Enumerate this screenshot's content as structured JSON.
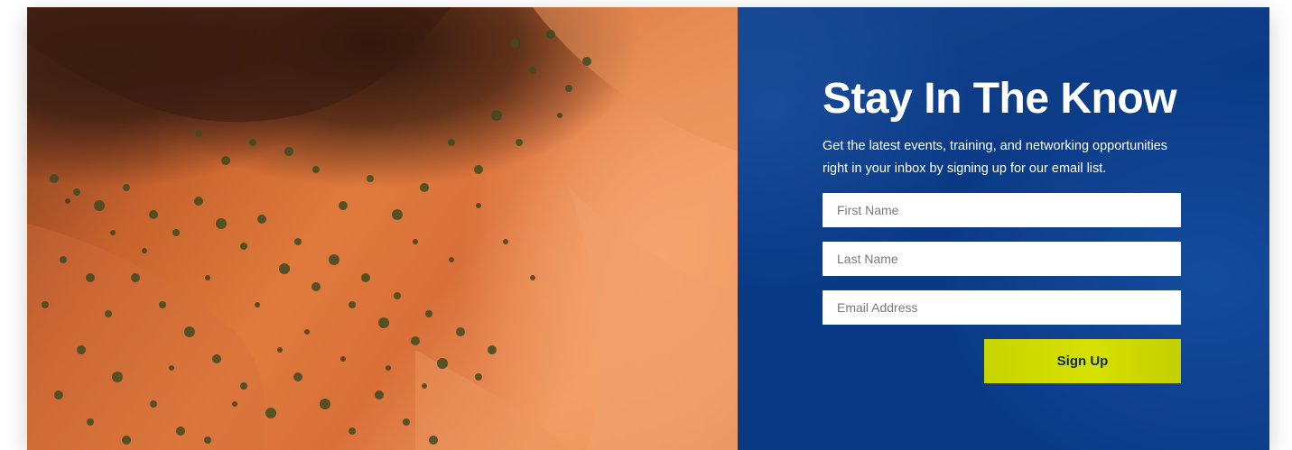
{
  "signup": {
    "title": "Stay In The Know",
    "description": "Get the latest events, training, and networking opportunities right in your inbox by signing up for our email list.",
    "fields": {
      "first_name": {
        "placeholder": "First Name",
        "value": ""
      },
      "last_name": {
        "placeholder": "Last Name",
        "value": ""
      },
      "email": {
        "placeholder": "Email Address",
        "value": ""
      }
    },
    "button_label": "Sign Up"
  },
  "colors": {
    "panel_background": "#0a3a86",
    "button_background": "#cfda00",
    "button_text": "#0b2b55",
    "text": "#ffffff"
  },
  "image": {
    "subject": "aerial-desert-canyon"
  }
}
